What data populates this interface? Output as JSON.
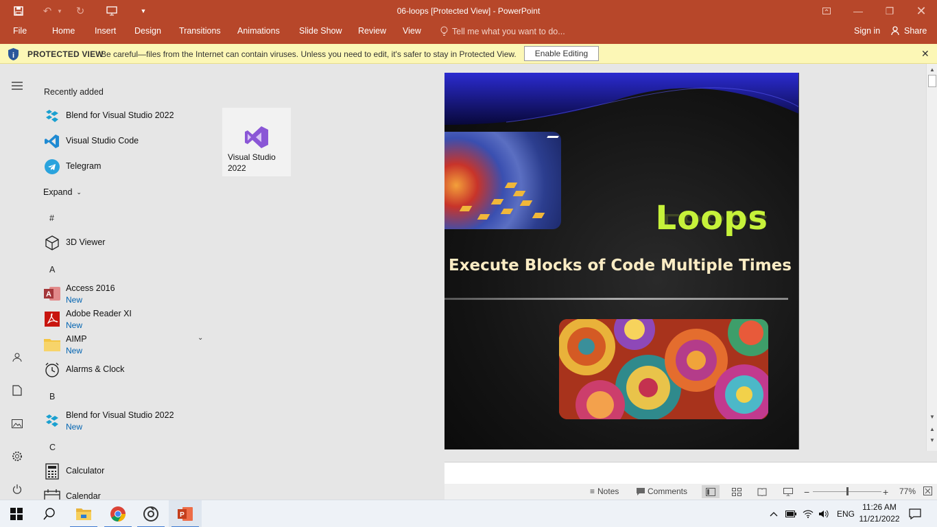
{
  "window": {
    "title": "06-loops [Protected View] - PowerPoint"
  },
  "ribbon": {
    "file": "File",
    "tabs": [
      "Home",
      "Insert",
      "Design",
      "Transitions",
      "Animations",
      "Slide Show",
      "Review",
      "View"
    ],
    "tell_me": "Tell me what you want to do...",
    "sign_in": "Sign in",
    "share": "Share"
  },
  "protected_view": {
    "heading": "PROTECTED VIEW",
    "message": "Be careful—files from the Internet can contain viruses. Unless you need to edit, it's safer to stay in Protected View.",
    "enable_button": "Enable Editing"
  },
  "slide": {
    "title": "Loops",
    "subtitle": "Execute Blocks of Code Multiple Times"
  },
  "status_bar": {
    "notes": "Notes",
    "comments": "Comments",
    "zoom": "77%",
    "zoom_level": 0.5
  },
  "start_menu": {
    "recently_added_heading": "Recently added",
    "recently_added": [
      {
        "name": "Blend for Visual Studio 2022",
        "icon": "blend-icon"
      },
      {
        "name": "Visual Studio Code",
        "icon": "vscode-icon"
      },
      {
        "name": "Telegram",
        "icon": "telegram-icon"
      }
    ],
    "expand": "Expand",
    "groups": {
      "hash": "#",
      "a": "A",
      "b": "B",
      "c": "C"
    },
    "apps": {
      "viewer3d": "3D Viewer",
      "access": "Access 2016",
      "adobe": "Adobe Reader XI",
      "aimp": "AIMP",
      "alarms": "Alarms & Clock",
      "blend": "Blend for Visual Studio 2022",
      "calculator": "Calculator",
      "calendar": "Calendar"
    },
    "new_badge": "New",
    "tile": "Visual Studio 2022"
  },
  "taskbar": {
    "language": "ENG",
    "time": "11:26 AM",
    "date": "11/21/2022"
  },
  "colors": {
    "powerpoint_red": "#b7472a",
    "banner_yellow": "#fcf7b6",
    "slide_title": "#c6f23a",
    "accent_blue": "#0063b1"
  }
}
